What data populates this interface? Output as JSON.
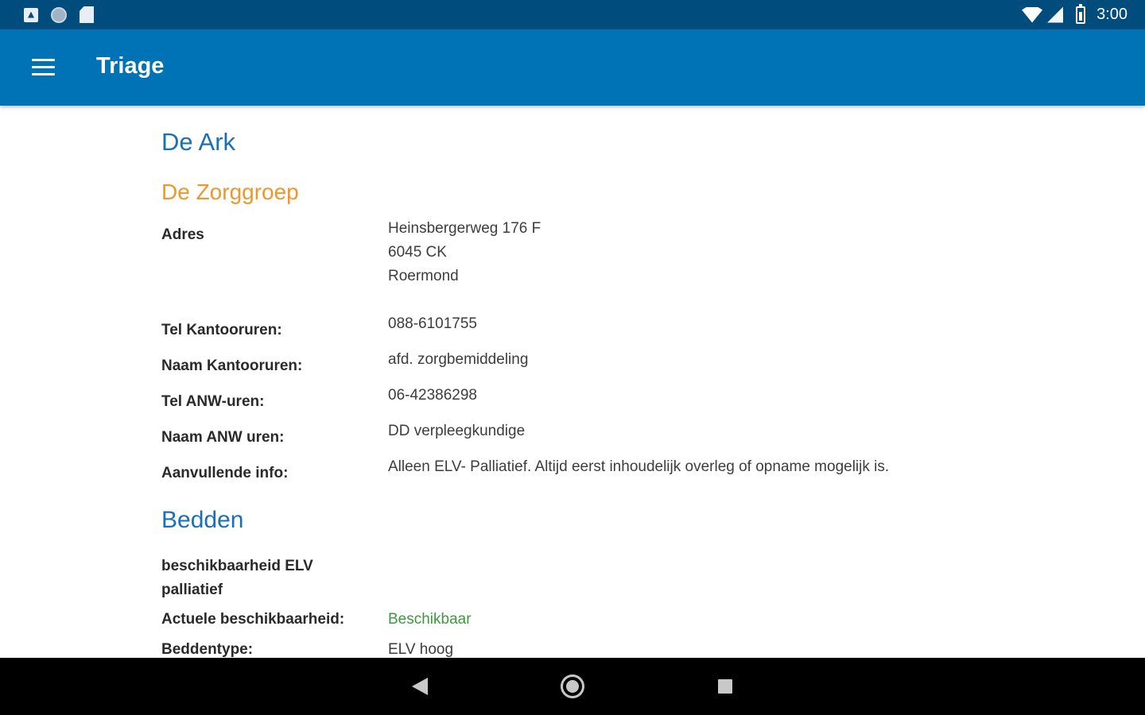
{
  "status_bar": {
    "time": "3:00",
    "icons": [
      "notification-a-icon",
      "circle-icon",
      "sd-card-icon",
      "wifi-icon",
      "signal-icon",
      "battery-icon"
    ]
  },
  "app_bar": {
    "title": "Triage",
    "menu_icon": "hamburger-menu-icon",
    "background_color": "#0073b7"
  },
  "organization": {
    "name": "De Ark",
    "group": "De Zorggroep"
  },
  "details": {
    "address_label": "Adres",
    "address_lines": [
      "Heinsbergerweg 176 F",
      "6045 CK",
      "Roermond"
    ],
    "tel_office_label": "Tel Kantooruren:",
    "tel_office_value": "088-6101755",
    "name_office_label": "Naam Kantooruren:",
    "name_office_value": "afd. zorgbemiddeling",
    "tel_anw_label": "Tel ANW-uren:",
    "tel_anw_value": "06-42386298",
    "name_anw_label": "Naam ANW uren:",
    "name_anw_value": "DD verpleegkundige",
    "extra_info_label": "Aanvullende info:",
    "extra_info_value": "Alleen ELV- Palliatief. Altijd eerst inhoudelijk overleg of opname mogelijk is."
  },
  "beds": {
    "heading": "Bedden",
    "availability_title": "beschikbaarheid ELV palliatief",
    "current_label": "Actuele beschikbaarheid:",
    "current_value": "Beschikbaar",
    "bedtype_label": "Beddentype:",
    "bedtype_value": "ELV hoog"
  },
  "colors": {
    "status_bar": "#004d7d",
    "heading_blue": "#1a6fb5",
    "group_orange": "#f0962a",
    "available_green": "#3b9a3b"
  },
  "nav_bar": {
    "icons": [
      "back-icon",
      "home-icon",
      "recent-apps-icon"
    ]
  }
}
